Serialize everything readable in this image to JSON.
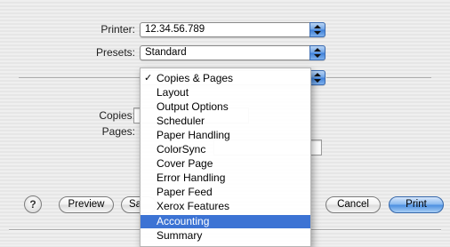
{
  "form": {
    "printer_label": "Printer:",
    "printer_value": "12.34.56.789",
    "presets_label": "Presets:",
    "presets_value": "Standard",
    "copies_label": "Copies:",
    "pages_label": "Pages:"
  },
  "pane_menu": {
    "checked_item": "Copies & Pages",
    "items": [
      "Copies & Pages",
      "Layout",
      "Output Options",
      "Scheduler",
      "Paper Handling",
      "ColorSync",
      "Cover Page",
      "Error Handling",
      "Paper Feed",
      "Xerox Features",
      "Accounting",
      "Summary"
    ],
    "highlighted_item": "Accounting"
  },
  "buttons": {
    "help": "?",
    "preview": "Preview",
    "save_partial": "Sa",
    "cancel": "Cancel",
    "print": "Print"
  },
  "icons": {
    "checkmark": "✓",
    "popup_arrows": "up-down-arrows-icon"
  },
  "colors": {
    "menu_highlight": "#3c73d4",
    "default_button": "#4a8ee0"
  }
}
